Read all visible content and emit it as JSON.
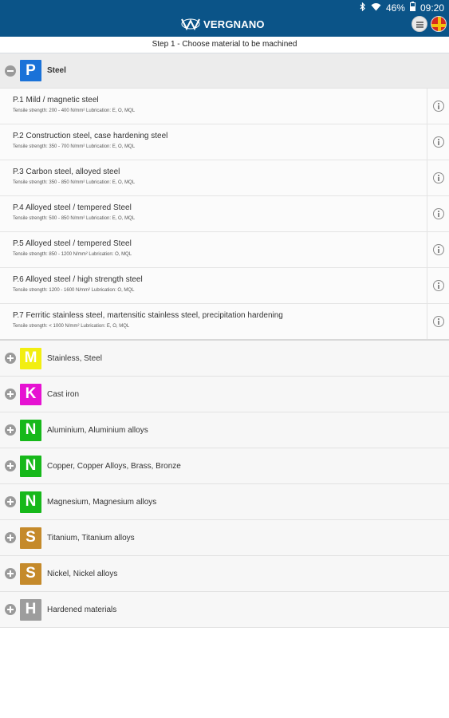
{
  "status": {
    "battery": "46%",
    "time": "09:20"
  },
  "app": {
    "logo_text": "VERGNANO"
  },
  "step": "Step 1 - Choose material to be machined",
  "colors": {
    "appbar": "#0b5488",
    "P": "#1a72d8",
    "M": "#f2ee10",
    "K": "#e612d2",
    "N": "#16b81a",
    "S": "#c58a2b",
    "H": "#9d9d9d"
  },
  "open_group": {
    "letter": "P",
    "name": "Steel",
    "icon": "minus-circle-icon"
  },
  "sub_items": [
    {
      "title": "P.1 Mild / magnetic steel",
      "detail": "Tensile strength: 200 - 400 N/mm²  Lubrication: E, O, MQL"
    },
    {
      "title": "P.2 Construction steel, case hardening steel",
      "detail": "Tensile strength: 350 - 700 N/mm²  Lubrication: E, O, MQL"
    },
    {
      "title": "P.3 Carbon steel, alloyed steel",
      "detail": "Tensile strength: 350 - 850 N/mm²  Lubrication: E, O, MQL"
    },
    {
      "title": "P.4 Alloyed steel / tempered Steel",
      "detail": "Tensile strength: 500 - 850 N/mm²  Lubrication: E, O, MQL"
    },
    {
      "title": "P.5 Alloyed steel / tempered Steel",
      "detail": "Tensile strength: 850 - 1200 N/mm²  Lubrication: O, MQL"
    },
    {
      "title": "P.6 Alloyed steel / high strength steel",
      "detail": "Tensile strength: 1200 - 1600 N/mm²  Lubrication: O, MQL"
    },
    {
      "title": "P.7 Ferritic stainless steel, martensitic stainless steel, precipitation hardening",
      "detail": "Tensile strength: < 1000 N/mm²  Lubrication: E, O, MQL"
    }
  ],
  "groups": [
    {
      "letter": "M",
      "name": "Stainless, Steel"
    },
    {
      "letter": "K",
      "name": "Cast iron"
    },
    {
      "letter": "N",
      "name": "Aluminium, Aluminium alloys"
    },
    {
      "letter": "N",
      "name": "Copper, Copper Alloys, Brass, Bronze"
    },
    {
      "letter": "N",
      "name": "Magnesium, Magnesium alloys"
    },
    {
      "letter": "S",
      "name": "Titanium, Titanium alloys"
    },
    {
      "letter": "S",
      "name": "Nickel, Nickel alloys"
    },
    {
      "letter": "H",
      "name": "Hardened materials"
    }
  ]
}
